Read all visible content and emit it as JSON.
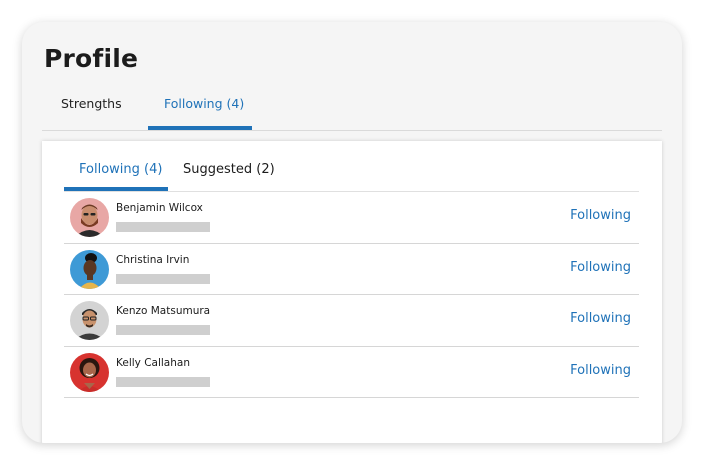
{
  "profile": {
    "title": "Profile"
  },
  "top_tabs": [
    {
      "label": "Strengths",
      "active": false
    },
    {
      "label": "Following (4)",
      "active": true
    }
  ],
  "sub_tabs": [
    {
      "label": "Following (4)",
      "active": true
    },
    {
      "label": "Suggested (2)",
      "active": false
    }
  ],
  "following": [
    {
      "name": "Benjamin Wilcox",
      "action": "Following",
      "avatar_bg": "#e8a7a5"
    },
    {
      "name": "Christina Irvin",
      "action": "Following",
      "avatar_bg": "#3e9ad6"
    },
    {
      "name": "Kenzo Matsumura",
      "action": "Following",
      "avatar_bg": "#d3d3d3"
    },
    {
      "name": "Kelly Callahan",
      "action": "Following",
      "avatar_bg": "#d7332f"
    }
  ],
  "colors": {
    "accent": "#1f72b8",
    "placeholder": "#cfcfcf"
  }
}
